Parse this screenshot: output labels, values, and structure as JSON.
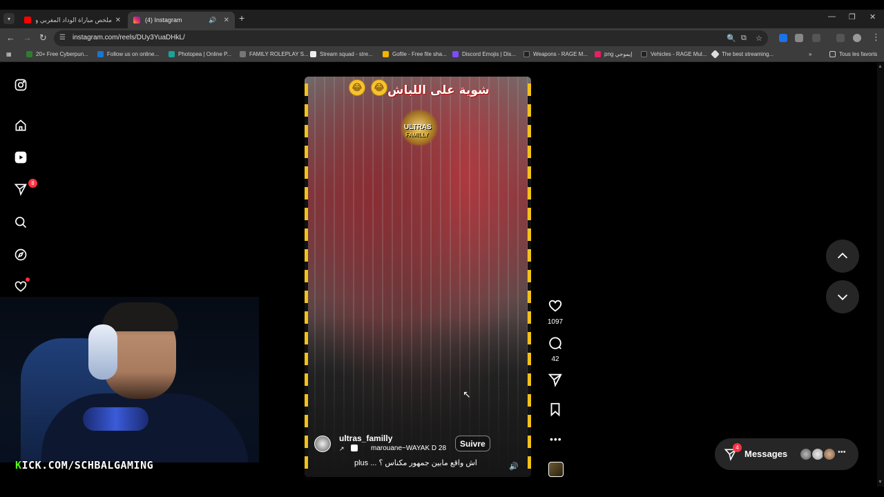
{
  "browser": {
    "tabs": [
      {
        "label": "ملخص مباراة الوداد المغربي وعز",
        "favicon_color": "#ff0000"
      },
      {
        "label": "(4) Instagram",
        "favicon_color": "#e1306c"
      }
    ],
    "url": "instagram.com/reels/DUy3YuaDHkL/",
    "bookmarks": [
      {
        "label": "20+ Free Cyberpun...",
        "color": "#2e7d32"
      },
      {
        "label": "Follow us on online...",
        "color": "#1976d2"
      },
      {
        "label": "Photopea | Online P...",
        "color": "#18a497"
      },
      {
        "label": "FAMILY ROLEPLAY S...",
        "color": "#777777"
      },
      {
        "label": "Stream squad - stre...",
        "color": "#eeeeee"
      },
      {
        "label": "Gofile - Free file sha...",
        "color": "#f5b400"
      },
      {
        "label": "Discord Emojis | Dis...",
        "color": "#7c4dff"
      },
      {
        "label": "Weapons - RAGE M...",
        "color": "#222222"
      },
      {
        "label": "png إيموجي",
        "color": "#e91e63"
      },
      {
        "label": "Vehicles - RAGE Mul...",
        "color": "#222222"
      },
      {
        "label": "The best streaming...",
        "color": "#dddddd"
      }
    ],
    "all_bookmarks": "Tous les favoris"
  },
  "sidebar": {
    "notifications_badge": "8",
    "icons": [
      "instagram-logo-icon",
      "home-icon",
      "reels-icon",
      "messages-icon",
      "search-icon",
      "explore-icon",
      "heart-icon",
      "create-icon",
      "dashboard-icon",
      "profile-avatar"
    ]
  },
  "overlay": {
    "kick_prefix": "K",
    "kick_text": "ICK.COM/SCHBALGAMING"
  },
  "reel": {
    "title": "شوية على اللباش",
    "logo_line1": "ULTRAS",
    "logo_line2": "FAMILLY",
    "username": "ultras_familly",
    "follow": "Suivre",
    "audio": "marouane~WAYAK D 28",
    "caption": "اش واقع مابين جمهور مكناس ؟ ... plus",
    "likes": "1097",
    "comments": "42"
  },
  "messages": {
    "label": "Messages",
    "badge": "4"
  },
  "colors": {
    "accent": "#ff3040",
    "kick_green": "#53fc18",
    "stripe_yellow": "#f2c21a"
  }
}
